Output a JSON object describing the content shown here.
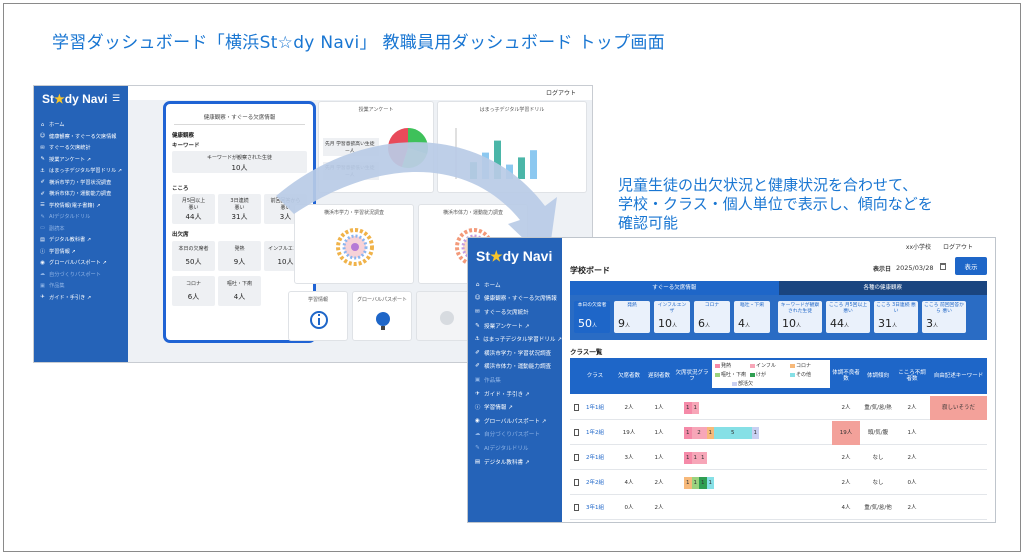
{
  "headline": "学習ダッシュボード「横浜St☆dy Navi」 教職員用ダッシュボード トップ画面",
  "description": [
    "児童生徒の出欠状況と健康状況を合わせて、",
    "学校・クラス・個人単位で表示し、傾向などを",
    "確認可能"
  ],
  "colors": {
    "sidebar": "#2563b8",
    "accent": "#1e66c8",
    "star": "#f7c52b",
    "alert": "#f3a19a",
    "text_blue": "#1976d2"
  },
  "back": {
    "logout": "ログアウト",
    "logo_pre": "St",
    "logo_star": "★",
    "logo_post": "dy Navi",
    "menu_icon": "☰",
    "nav": [
      {
        "icon": "⌂",
        "label": "ホーム"
      },
      {
        "icon": "☺",
        "label": "健康観察・すぐーる欠席情報"
      },
      {
        "icon": "✉",
        "label": "すぐーる欠席統計"
      },
      {
        "icon": "✎",
        "label": "授業アンケート ↗"
      },
      {
        "icon": "⚓",
        "label": "はまっ子デジタル学習ドリル ↗"
      },
      {
        "icon": "✐",
        "label": "横浜市学力・学習状況調査"
      },
      {
        "icon": "✐",
        "label": "横浜市体力・運動能力調査"
      },
      {
        "icon": "☰",
        "label": "学校情報(電子書籍) ↗"
      },
      {
        "icon": "✎",
        "label": "AIデジタルドリル",
        "dim": true
      },
      {
        "icon": "▭",
        "label": "副読本",
        "dim": true
      },
      {
        "icon": "▤",
        "label": "デジタル教科書 ↗"
      },
      {
        "icon": "ⓘ",
        "label": "学習情報 ↗"
      },
      {
        "icon": "◉",
        "label": "グローバルパスポート ↗"
      },
      {
        "icon": "☁",
        "label": "自分づくりパスポート",
        "dim": true
      },
      {
        "icon": "▣",
        "label": "作品集",
        "dim": true
      },
      {
        "icon": "✈",
        "label": "ガイド・手引き ↗"
      }
    ],
    "health_card": {
      "title": "健康観察・すぐーる欠席情報",
      "section1": "健康観察",
      "section1_sub": "キーワード",
      "keyword_label": "キーワードが観察された生徒",
      "keyword_value": "10人",
      "section2": "こころ",
      "kokoro": [
        {
          "label": "月5回以上",
          "sub": "悪い",
          "value": "44人"
        },
        {
          "label": "3日連続",
          "sub": "悪い",
          "value": "31人"
        },
        {
          "label": "前回回答から",
          "sub": "悪い",
          "value": "3人"
        }
      ],
      "section3": "出欠席",
      "absence": [
        {
          "label": "本日の欠席者",
          "value": "50人"
        },
        {
          "label": "発熱",
          "value": "9人"
        },
        {
          "label": "インフルエンザ",
          "value": "10人"
        },
        {
          "label": "コロナ",
          "value": "6人"
        },
        {
          "label": "嘔吐・下痢",
          "value": "4人"
        }
      ]
    },
    "survey": {
      "title": "授業アンケート",
      "row1": "先月 学習意欲高い生徒",
      "row2": "先月 学習意欲低い生徒",
      "row1_value": "ー人",
      "row2_value": "ー人",
      "pie": [
        0.3,
        0.25,
        0.45
      ]
    },
    "drill": {
      "title": "はまっ子デジタル学習ドリル",
      "bars": [
        0.35,
        0.55,
        0.8,
        0.3,
        0.45,
        0.6
      ]
    },
    "gakuryoku": {
      "title": "横浜市学力・学習状況調査"
    },
    "tairyoku": {
      "title": "横浜市体力・運動能力調査"
    },
    "tiles": [
      {
        "title": "学習情報",
        "icon": "info-icon"
      },
      {
        "title": "グローバルパスポート",
        "icon": "globe-icon"
      },
      {
        "title": "",
        "icon": "ghost-icon"
      },
      {
        "title": "",
        "icon": "rocket-icon"
      }
    ]
  },
  "front": {
    "logo_pre": "St",
    "logo_star": "★",
    "logo_post": "dy Navi",
    "school": "xx小学校",
    "logout": "ログアウト",
    "board_title": "学校ボード",
    "date_label": "表示日",
    "date": "2025/03/28",
    "show_button": "表示",
    "nav": [
      {
        "icon": "⌂",
        "label": "ホーム"
      },
      {
        "icon": "☺",
        "label": "健康観察・すぐーる欠席情報"
      },
      {
        "icon": "✉",
        "label": "すぐーる欠席統計"
      },
      {
        "icon": "✎",
        "label": "授業アンケート ↗"
      },
      {
        "icon": "⚓",
        "label": "はまっ子デジタル学習ドリル ↗"
      },
      {
        "icon": "✐",
        "label": "横浜市学力・学習状況調査"
      },
      {
        "icon": "✐",
        "label": "横浜市体力・運動能力調査"
      },
      {
        "icon": "▣",
        "label": "作品集",
        "dim": true
      },
      {
        "icon": "✈",
        "label": "ガイド・手引き ↗"
      },
      {
        "icon": "ⓘ",
        "label": "学習情報 ↗"
      },
      {
        "icon": "◉",
        "label": "グローバルパスポート ↗"
      },
      {
        "icon": "☁",
        "label": "自分づくりパスポート",
        "dim": true
      },
      {
        "icon": "✎",
        "label": "AIデジタルドリル",
        "dim": true
      },
      {
        "icon": "▤",
        "label": "デジタル教科書 ↗"
      }
    ],
    "tabs": [
      "すぐーる欠席情報",
      "各種の健康観察"
    ],
    "stats": [
      {
        "label": "本日の欠席者",
        "value": "50",
        "unit": "人",
        "main": true
      },
      {
        "label": "発熱",
        "value": "9",
        "unit": "人"
      },
      {
        "label": "インフルエンザ",
        "value": "10",
        "unit": "人"
      },
      {
        "label": "コロナ",
        "value": "6",
        "unit": "人"
      },
      {
        "label": "嘔吐・下痢",
        "value": "4",
        "unit": "人"
      },
      {
        "label": "キーワードが観察された生徒",
        "value": "10",
        "unit": "人"
      },
      {
        "label": "こころ 月5回以上 悪い",
        "value": "44",
        "unit": "人"
      },
      {
        "label": "こころ 3日連続 悪い",
        "value": "31",
        "unit": "人"
      },
      {
        "label": "こころ 前回回答から 悪い",
        "value": "3",
        "unit": "人"
      }
    ],
    "list_title": "クラス一覧",
    "columns": [
      "クラス",
      "欠席者数",
      "遅刻者数",
      "欠席状況グラフ",
      "体調不良者数",
      "体調傾向",
      "こころ不調者数",
      "自由記述キーワード"
    ],
    "legend": [
      {
        "name": "発熱",
        "color": "#f58aa8"
      },
      {
        "name": "インフル",
        "color": "#f7a6b8"
      },
      {
        "name": "コロナ",
        "color": "#f7b97a"
      },
      {
        "name": "嘔吐・下痢",
        "color": "#9ad27e"
      },
      {
        "name": "けが",
        "color": "#2f9e52"
      },
      {
        "name": "その他",
        "color": "#86e0e6"
      },
      {
        "name": "部活欠",
        "color": "#c9d0f2"
      }
    ],
    "rows": [
      {
        "cls": "1年1組",
        "abs": "2人",
        "late": "1人",
        "bars": [
          {
            "v": 1,
            "c": "#f58aa8"
          },
          {
            "v": 1,
            "c": "#f7a6b8"
          }
        ],
        "sick": "2人",
        "trend": "重/気/怠/熱",
        "kokoro": "2人",
        "kw": "寂しいそうだ",
        "alert_kw": true
      },
      {
        "cls": "1年2組",
        "abs": "19人",
        "late": "1人",
        "bars": [
          {
            "v": 1,
            "c": "#f58aa8"
          },
          {
            "v": 2,
            "c": "#f7a6b8"
          },
          {
            "v": 1,
            "c": "#f7b97a"
          },
          {
            "v": 5,
            "c": "#86e0e6"
          },
          {
            "v": 1,
            "c": "#c9d0f2"
          }
        ],
        "sick": "19人",
        "trend": "頭/気/腹",
        "kokoro": "1人",
        "kw": "",
        "alert_sick": true
      },
      {
        "cls": "2年1組",
        "abs": "3人",
        "late": "1人",
        "bars": [
          {
            "v": 1,
            "c": "#f58aa8"
          },
          {
            "v": 1,
            "c": "#f7a6b8"
          },
          {
            "v": 1,
            "c": "#f7a6b8"
          }
        ],
        "sick": "2人",
        "trend": "なし",
        "kokoro": "2人",
        "kw": ""
      },
      {
        "cls": "2年2組",
        "abs": "4人",
        "late": "2人",
        "bars": [
          {
            "v": 1,
            "c": "#f7b97a"
          },
          {
            "v": 1,
            "c": "#9ad27e"
          },
          {
            "v": 1,
            "c": "#2f9e52"
          },
          {
            "v": 1,
            "c": "#86e0e6"
          }
        ],
        "sick": "2人",
        "trend": "なし",
        "kokoro": "0人",
        "kw": ""
      },
      {
        "cls": "3年1組",
        "abs": "0人",
        "late": "2人",
        "bars": [],
        "sick": "4人",
        "trend": "重/気/怠/他",
        "kokoro": "2人",
        "kw": ""
      }
    ]
  }
}
